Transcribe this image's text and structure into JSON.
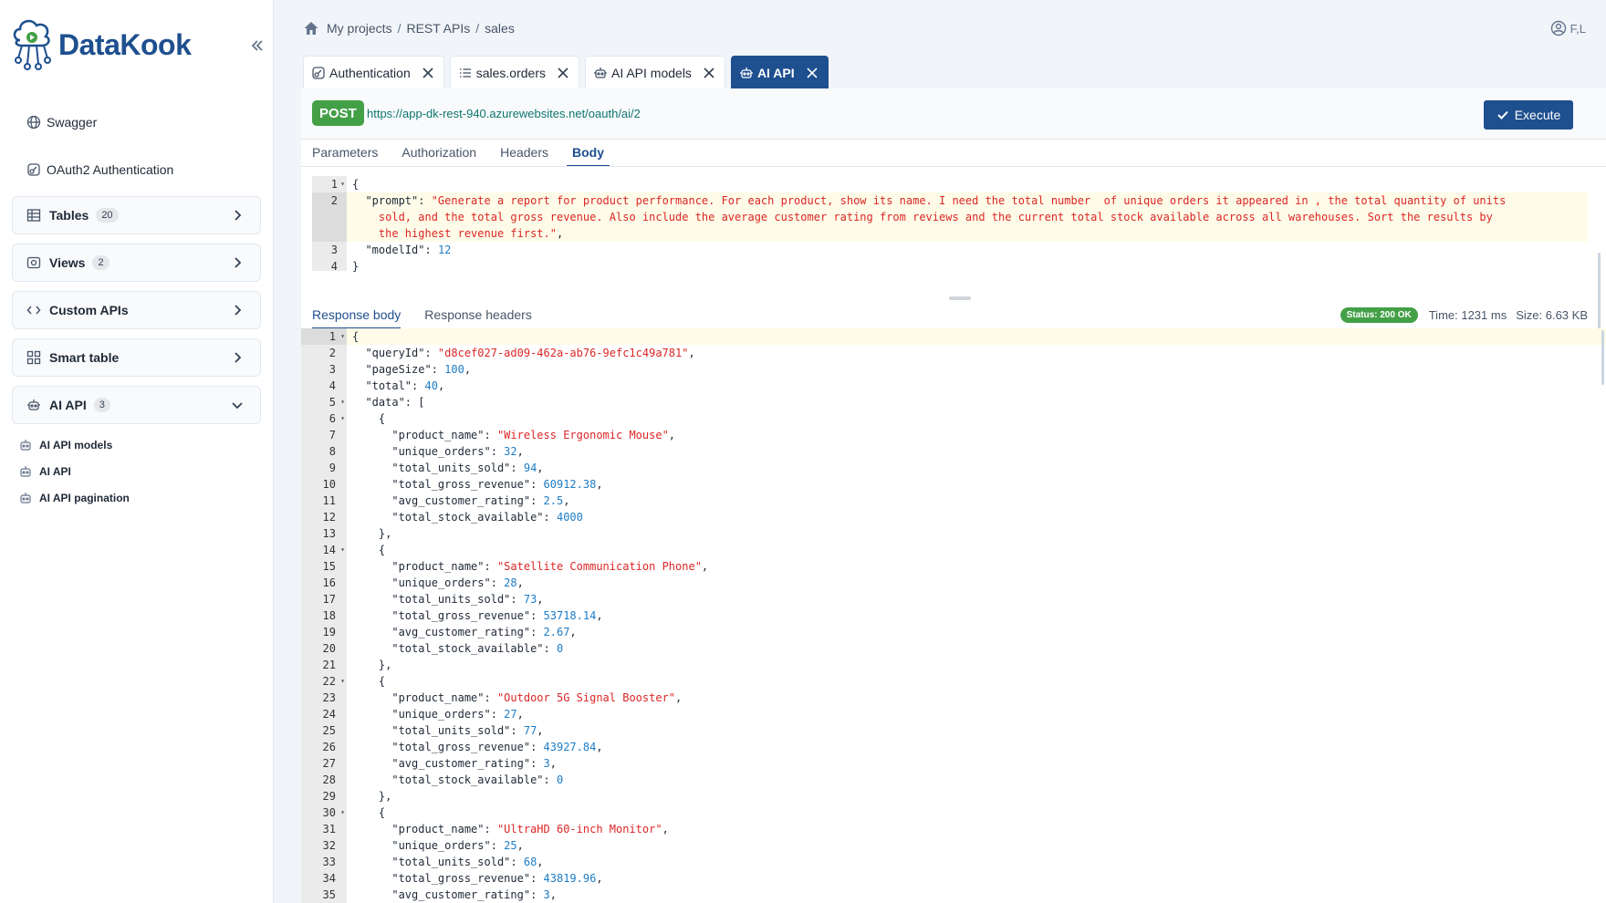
{
  "brand": {
    "name": "DataKook"
  },
  "sidebar": {
    "links": [
      {
        "label": "Swagger",
        "icon": "globe-icon"
      },
      {
        "label": "OAuth2 Authentication",
        "icon": "key-icon"
      }
    ],
    "cards": [
      {
        "label": "Tables",
        "badge": "20",
        "icon": "table-icon",
        "expanded": false
      },
      {
        "label": "Views",
        "badge": "2",
        "icon": "eye-icon",
        "expanded": false
      },
      {
        "label": "Custom APIs",
        "badge": "",
        "icon": "code-icon",
        "expanded": false
      },
      {
        "label": "Smart table",
        "badge": "",
        "icon": "grid-icon",
        "expanded": false
      },
      {
        "label": "AI API",
        "badge": "3",
        "icon": "robot-icon",
        "expanded": true
      }
    ],
    "ai_items": [
      "AI API models",
      "AI API",
      "AI API pagination"
    ]
  },
  "breadcrumb": {
    "items": [
      "My projects",
      "REST APIs",
      "sales"
    ],
    "sep": "/"
  },
  "user": {
    "initials": "F,L"
  },
  "tabs": [
    {
      "label": "Authentication",
      "icon": "key-icon",
      "active": false
    },
    {
      "label": "sales.orders",
      "icon": "list-icon",
      "active": false
    },
    {
      "label": "AI API models",
      "icon": "robot-icon",
      "active": false
    },
    {
      "label": "AI API",
      "icon": "robot-icon",
      "active": true
    }
  ],
  "request": {
    "method": "POST",
    "url": "https://app-dk-rest-940.azurewebsites.net/oauth/ai/2",
    "execute_label": "Execute",
    "subtabs": [
      "Parameters",
      "Authorization",
      "Headers",
      "Body"
    ],
    "active_subtab": "Body",
    "body": {
      "prompt_line1": "\"Generate a report for product performance. For each product, show its name. I need the total number  of unique orders it appeared in , the total quantity of units",
      "prompt_line2": "sold, and the total gross revenue. Also include the average customer rating from reviews and the current total stock available across all warehouses. Sort the results by",
      "prompt_line3": "the highest revenue first.\"",
      "modelId": "12"
    }
  },
  "response": {
    "tabs": [
      "Response body",
      "Response headers"
    ],
    "status": "Status: 200 OK",
    "time": "Time: 1231 ms",
    "size": "Size: 6.63 KB",
    "queryId": "\"d8cef027-ad09-462a-ab76-9efc1c49a781\"",
    "pageSize": "100",
    "total": "40",
    "data": [
      {
        "product_name": "\"Wireless Ergonomic Mouse\"",
        "unique_orders": "32",
        "total_units_sold": "94",
        "total_gross_revenue": "60912.38",
        "avg_customer_rating": "2.5",
        "total_stock_available": "4000"
      },
      {
        "product_name": "\"Satellite Communication Phone\"",
        "unique_orders": "28",
        "total_units_sold": "73",
        "total_gross_revenue": "53718.14",
        "avg_customer_rating": "2.67",
        "total_stock_available": "0"
      },
      {
        "product_name": "\"Outdoor 5G Signal Booster\"",
        "unique_orders": "27",
        "total_units_sold": "77",
        "total_gross_revenue": "43927.84",
        "avg_customer_rating": "3",
        "total_stock_available": "0"
      },
      {
        "product_name": "\"UltraHD 60-inch Monitor\"",
        "unique_orders": "25",
        "total_units_sold": "68",
        "total_gross_revenue": "43819.96",
        "avg_customer_rating": "3"
      }
    ]
  },
  "colors": {
    "accent": "#1e4f8f",
    "method": "#43a047",
    "string": "#dc2626",
    "number": "#1d7dc7"
  }
}
